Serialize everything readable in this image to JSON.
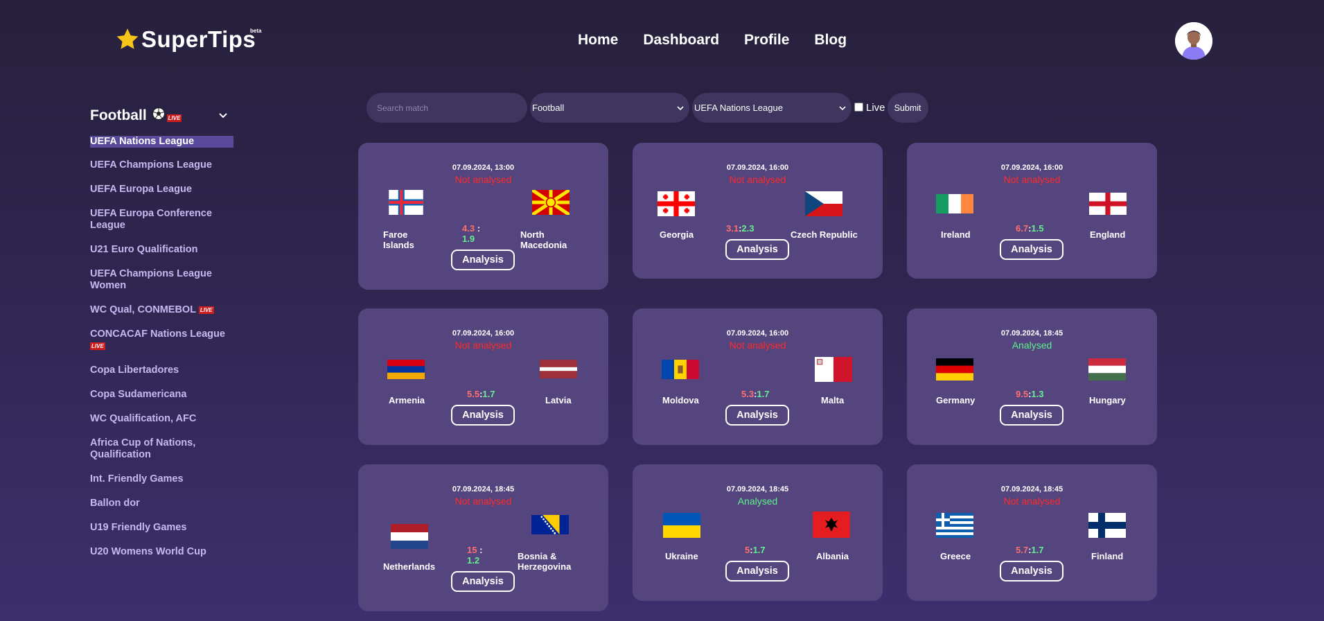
{
  "app": {
    "logo_text": "SuperTips",
    "logo_badge": "beta"
  },
  "nav": {
    "home": "Home",
    "dashboard": "Dashboard",
    "profile": "Profile",
    "blog": "Blog"
  },
  "sidebar": {
    "sport": "Football",
    "live_badge": "LIVE",
    "leagues": [
      "UEFA Nations League",
      "UEFA Champions League",
      "UEFA Europa League",
      "UEFA Europa Conference League",
      "U21 Euro Qualification",
      "UEFA Champions League Women",
      "WC Qual, CONMEBOL",
      "CONCACAF Nations League",
      "Copa Libertadores",
      "Copa Sudamericana",
      "WC Qualification, AFC",
      "Africa Cup of Nations, Qualification",
      "Int. Friendly Games",
      "Ballon dor",
      "U19 Friendly Games",
      "U20 Womens World Cup"
    ]
  },
  "filters": {
    "search_placeholder": "Search match",
    "sport": "Football",
    "league": "UEFA Nations League",
    "live_label": "Live",
    "submit": "Submit"
  },
  "cards": {
    "analysis_label": "Analysis",
    "matches": [
      {
        "datetime": "07.09.2024, 13:00",
        "status": "Not analysed",
        "home": "Faroe Islands",
        "away": "North Macedonia",
        "odd_home": "4.3",
        "odd_away": "1.9",
        "sep": ":"
      },
      {
        "datetime": "07.09.2024, 16:00",
        "status": "Not analysed",
        "home": "Georgia",
        "away": "Czech Republic",
        "odd_home": "3.1",
        "odd_away": "2.3",
        "sep": ":"
      },
      {
        "datetime": "07.09.2024, 16:00",
        "status": "Not analysed",
        "home": "Ireland",
        "away": "England",
        "odd_home": "6.7",
        "odd_away": "1.5",
        "sep": ":"
      },
      {
        "datetime": "07.09.2024, 16:00",
        "status": "Not analysed",
        "home": "Armenia",
        "away": "Latvia",
        "odd_home": "5.5",
        "odd_away": "1.7",
        "sep": ":"
      },
      {
        "datetime": "07.09.2024, 16:00",
        "status": "Not analysed",
        "home": "Moldova",
        "away": "Malta",
        "odd_home": "5.3",
        "odd_away": "1.7",
        "sep": ":"
      },
      {
        "datetime": "07.09.2024, 18:45",
        "status": "Analysed",
        "home": "Germany",
        "away": "Hungary",
        "odd_home": "9.5",
        "odd_away": "1.3",
        "sep": ":"
      },
      {
        "datetime": "07.09.2024, 18:45",
        "status": "Not analysed",
        "home": "Netherlands",
        "away": "Bosnia & Herzegovina",
        "odd_home": "15",
        "odd_away": "1.2",
        "sep": ":"
      },
      {
        "datetime": "07.09.2024, 18:45",
        "status": "Analysed",
        "home": "Ukraine",
        "away": "Albania",
        "odd_home": "5",
        "odd_away": "1.7",
        "sep": ":"
      },
      {
        "datetime": "07.09.2024, 18:45",
        "status": "Not analysed",
        "home": "Greece",
        "away": "Finland",
        "odd_home": "5.7",
        "odd_away": "1.7",
        "sep": ":"
      }
    ]
  },
  "icons": {
    "logo": "star-icon",
    "sport": "soccer-ball-icon",
    "collapse": "chevron-down-icon",
    "avatar": "user-avatar"
  },
  "colors": {
    "card_bg": "#54457f",
    "not_analysed": "#ff2a2a",
    "analysed": "#5ef08c",
    "odd_home": "#ff6e6e",
    "odd_away": "#65f08f",
    "active_league_bg": "#5a4a9c"
  }
}
